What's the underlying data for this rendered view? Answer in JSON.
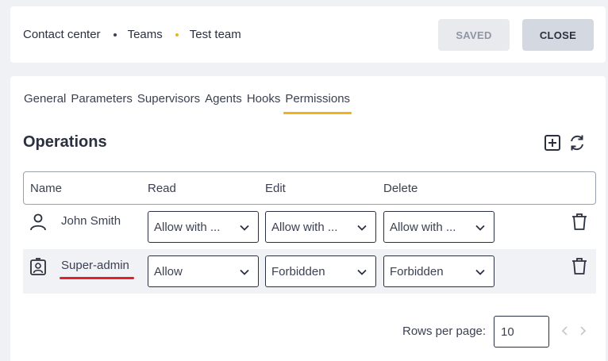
{
  "breadcrumb": {
    "items": [
      "Contact center",
      "Teams",
      "Test team"
    ]
  },
  "buttons": {
    "saved": "SAVED",
    "close": "CLOSE"
  },
  "tabs": [
    "General",
    "Parameters",
    "Supervisors",
    "Agents",
    "Hooks",
    "Permissions"
  ],
  "active_tab": "Permissions",
  "section": {
    "title": "Operations"
  },
  "table": {
    "headers": {
      "name": "Name",
      "read": "Read",
      "edit": "Edit",
      "delete": "Delete"
    },
    "rows": [
      {
        "icon": "user-icon",
        "name": "John Smith",
        "read": "Allow with ...",
        "edit": "Allow with ...",
        "delete": "Allow with ..."
      },
      {
        "icon": "role-badge-icon",
        "name": "Super-admin",
        "read": "Allow",
        "edit": "Forbidden",
        "delete": "Forbidden"
      }
    ]
  },
  "pagination": {
    "rows_per_page_label": "Rows per page:",
    "rows_per_page_value": "10"
  },
  "colors": {
    "accent": "#f2b31a",
    "annotation": "#e0202a",
    "text": "#2b3040"
  }
}
